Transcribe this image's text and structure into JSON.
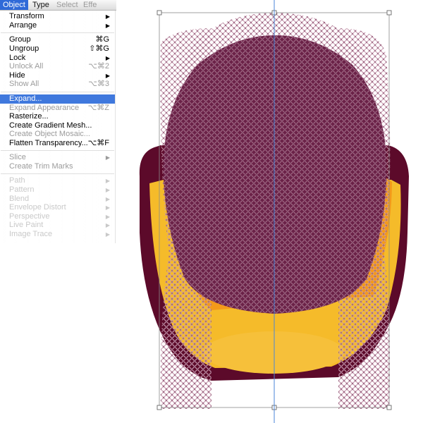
{
  "menubar": {
    "items": [
      {
        "label": "Object",
        "state": "active"
      },
      {
        "label": "Type",
        "state": "normal"
      },
      {
        "label": "Select",
        "state": "faded"
      },
      {
        "label": "Effe",
        "state": "faded"
      }
    ]
  },
  "object_menu": {
    "items": [
      {
        "label": "Transform",
        "shortcut": "",
        "submenu": true,
        "state": "enabled"
      },
      {
        "label": "Arrange",
        "shortcut": "",
        "submenu": true,
        "state": "enabled"
      },
      {
        "label": "Group",
        "shortcut": "⌘G",
        "submenu": false,
        "state": "enabled"
      },
      {
        "label": "Ungroup",
        "shortcut": "⇧⌘G",
        "submenu": false,
        "state": "enabled"
      },
      {
        "label": "Lock",
        "shortcut": "",
        "submenu": true,
        "state": "enabled"
      },
      {
        "label": "Unlock All",
        "shortcut": "⌥⌘2",
        "submenu": false,
        "state": "disabled"
      },
      {
        "label": "Hide",
        "shortcut": "",
        "submenu": true,
        "state": "enabled"
      },
      {
        "label": "Show All",
        "shortcut": "⌥⌘3",
        "submenu": false,
        "state": "disabled"
      },
      {
        "label": "Expand...",
        "shortcut": "",
        "submenu": false,
        "state": "highlighted"
      },
      {
        "label": "Expand Appearance",
        "shortcut": "⌥⌘Z",
        "submenu": false,
        "state": "disabled"
      },
      {
        "label": "Rasterize...",
        "shortcut": "",
        "submenu": false,
        "state": "enabled"
      },
      {
        "label": "Create Gradient Mesh...",
        "shortcut": "",
        "submenu": false,
        "state": "enabled"
      },
      {
        "label": "Create Object Mosaic...",
        "shortcut": "",
        "submenu": false,
        "state": "disabled"
      },
      {
        "label": "Flatten Transparency...",
        "shortcut": "⌥⌘F",
        "submenu": false,
        "state": "enabled"
      },
      {
        "label": "Slice",
        "shortcut": "",
        "submenu": true,
        "state": "disabled"
      },
      {
        "label": "Create Trim Marks",
        "shortcut": "",
        "submenu": false,
        "state": "disabled"
      },
      {
        "label": "Path",
        "shortcut": "",
        "submenu": true,
        "state": "ghost"
      },
      {
        "label": "Pattern",
        "shortcut": "",
        "submenu": true,
        "state": "ghost"
      },
      {
        "label": "Blend",
        "shortcut": "",
        "submenu": true,
        "state": "ghost"
      },
      {
        "label": "Envelope Distort",
        "shortcut": "",
        "submenu": true,
        "state": "ghost"
      },
      {
        "label": "Perspective",
        "shortcut": "",
        "submenu": true,
        "state": "ghost"
      },
      {
        "label": "Live Paint",
        "shortcut": "",
        "submenu": true,
        "state": "ghost"
      },
      {
        "label": "Image Trace",
        "shortcut": "",
        "submenu": true,
        "state": "ghost"
      }
    ]
  },
  "artwork": {
    "colors": {
      "maroon": "#5c0a2a",
      "face": "#6b2248",
      "yellow": "#f5bb2a",
      "orange": "#f39a1a",
      "mesh_dot": "#b87f9a",
      "guide": "#4a86d8",
      "selection": "#7a7a7a"
    }
  }
}
